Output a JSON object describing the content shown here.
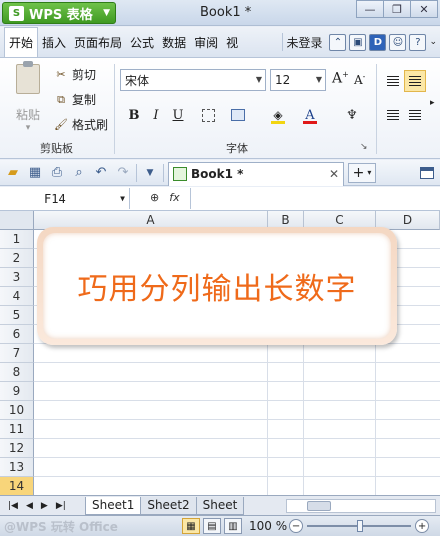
{
  "app": {
    "brand": "WPS 表格",
    "title": "Book1 *"
  },
  "menu_tabs": [
    "开始",
    "插入",
    "页面布局",
    "公式",
    "数据",
    "审阅",
    "视"
  ],
  "menu_right": {
    "login": "未登录"
  },
  "clipboard": {
    "paste": "粘贴",
    "cut": "剪切",
    "copy": "复制",
    "format_painter": "格式刷",
    "group": "剪贴板"
  },
  "font": {
    "name": "宋体",
    "size": "12",
    "group": "字体",
    "bold": "B",
    "italic": "I",
    "underline": "U",
    "fill_color": "#f2d511",
    "font_color": "#e01818"
  },
  "toolbar": {
    "doc_tab": "Book1 *",
    "new_tab": "+"
  },
  "formula_bar": {
    "cell_ref": "F14",
    "formula": ""
  },
  "grid": {
    "columns": [
      "A",
      "B",
      "C",
      "D"
    ],
    "rows": [
      "1",
      "2",
      "3",
      "4",
      "5",
      "6",
      "7",
      "8",
      "9",
      "10",
      "11",
      "12",
      "13",
      "14"
    ],
    "selected_row": "14"
  },
  "banner": {
    "text": "巧用分列输出长数字"
  },
  "sheets": [
    "Sheet1",
    "Sheet2",
    "Sheet"
  ],
  "status": {
    "watermark": "@WPS 玩转 Office",
    "zoom": "100 %"
  }
}
